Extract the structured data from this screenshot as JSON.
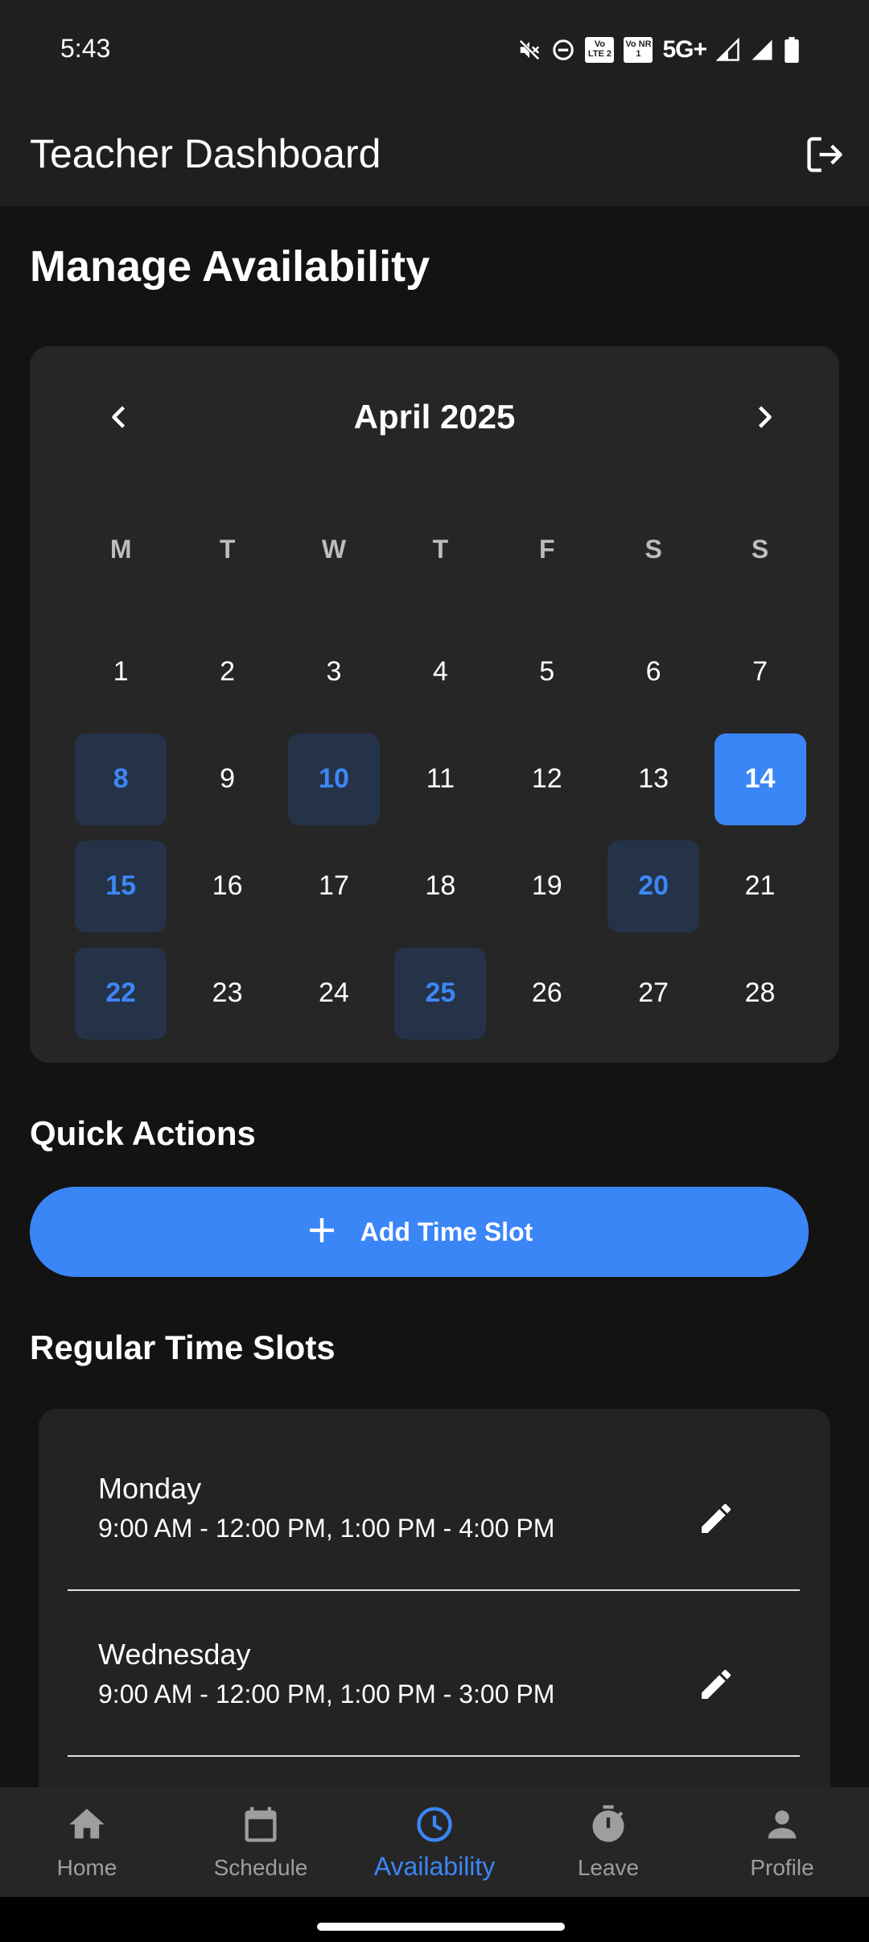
{
  "status_bar": {
    "time": "5:43",
    "network": "5G+",
    "sim1": "Vo LTE 2",
    "sim2": "Vo NR 1",
    "icons": [
      "mute-icon",
      "dnd-icon",
      "signal-icon",
      "signal-icon",
      "battery-icon"
    ]
  },
  "app_bar": {
    "title": "Teacher Dashboard",
    "logout_icon": "logout-icon"
  },
  "page": {
    "heading": "Manage Availability"
  },
  "calendar": {
    "month_label": "April 2025",
    "prev_icon": "chevron-left-icon",
    "next_icon": "chevron-right-icon",
    "weekdays": [
      "M",
      "T",
      "W",
      "T",
      "F",
      "S",
      "S"
    ],
    "days": [
      {
        "label": "1",
        "state": "normal"
      },
      {
        "label": "2",
        "state": "normal"
      },
      {
        "label": "3",
        "state": "normal"
      },
      {
        "label": "4",
        "state": "normal"
      },
      {
        "label": "5",
        "state": "normal"
      },
      {
        "label": "6",
        "state": "normal"
      },
      {
        "label": "7",
        "state": "normal"
      },
      {
        "label": "8",
        "state": "available"
      },
      {
        "label": "9",
        "state": "normal"
      },
      {
        "label": "10",
        "state": "available"
      },
      {
        "label": "11",
        "state": "normal"
      },
      {
        "label": "12",
        "state": "normal"
      },
      {
        "label": "13",
        "state": "normal"
      },
      {
        "label": "14",
        "state": "selected"
      },
      {
        "label": "15",
        "state": "available"
      },
      {
        "label": "16",
        "state": "normal"
      },
      {
        "label": "17",
        "state": "normal"
      },
      {
        "label": "18",
        "state": "normal"
      },
      {
        "label": "19",
        "state": "normal"
      },
      {
        "label": "20",
        "state": "available"
      },
      {
        "label": "21",
        "state": "normal"
      },
      {
        "label": "22",
        "state": "available"
      },
      {
        "label": "23",
        "state": "normal"
      },
      {
        "label": "24",
        "state": "normal"
      },
      {
        "label": "25",
        "state": "available"
      },
      {
        "label": "26",
        "state": "normal"
      },
      {
        "label": "27",
        "state": "normal"
      },
      {
        "label": "28",
        "state": "normal"
      }
    ]
  },
  "quick_actions": {
    "title": "Quick Actions",
    "add_button_label": "Add Time Slot",
    "add_icon": "plus-icon"
  },
  "regular_slots": {
    "title": "Regular Time Slots",
    "items": [
      {
        "day": "Monday",
        "times": "9:00 AM - 12:00 PM, 1:00 PM - 4:00 PM"
      },
      {
        "day": "Wednesday",
        "times": "9:00 AM - 12:00 PM, 1:00 PM - 3:00 PM"
      }
    ]
  },
  "bottom_nav": {
    "items": [
      {
        "label": "Home",
        "icon": "home-icon",
        "active": false
      },
      {
        "label": "Schedule",
        "icon": "calendar-icon",
        "active": false
      },
      {
        "label": "Availability",
        "icon": "clock-icon",
        "active": true
      },
      {
        "label": "Leave",
        "icon": "timer-icon",
        "active": false
      },
      {
        "label": "Profile",
        "icon": "person-icon",
        "active": false
      }
    ]
  },
  "colors": {
    "background": "#131313",
    "surface": "#1f1f1f",
    "card": "#262626",
    "accent": "#3b86f7",
    "available_bg": "#253348",
    "available_text": "#3d86f5",
    "muted_text": "#9e9e9e"
  }
}
